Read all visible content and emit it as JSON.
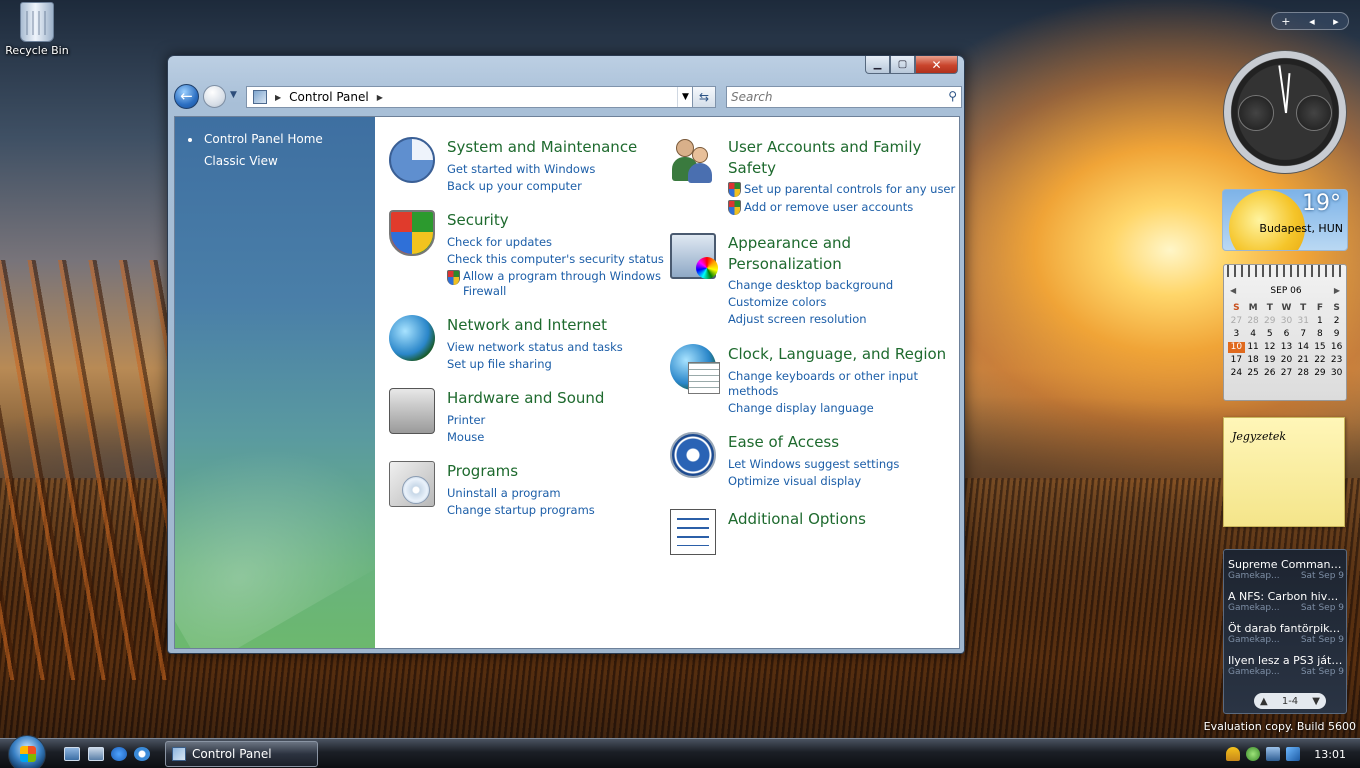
{
  "desktop": {
    "recycle_bin_label": "Recycle Bin",
    "evaluation_text": "Evaluation copy. Build 5600"
  },
  "window": {
    "address": {
      "segment": "Control Panel"
    },
    "search": {
      "placeholder": "Search"
    },
    "sidebar": {
      "home_label": "Control Panel Home",
      "classic_label": "Classic View"
    },
    "categories": {
      "system": {
        "title": "System and Maintenance",
        "links": [
          "Get started with Windows",
          "Back up your computer"
        ]
      },
      "security": {
        "title": "Security",
        "links": [
          "Check for updates",
          "Check this computer's security status",
          "Allow a program through Windows Firewall"
        ]
      },
      "network": {
        "title": "Network and Internet",
        "links": [
          "View network status and tasks",
          "Set up file sharing"
        ]
      },
      "hardware": {
        "title": "Hardware and Sound",
        "links": [
          "Printer",
          "Mouse"
        ]
      },
      "programs": {
        "title": "Programs",
        "links": [
          "Uninstall a program",
          "Change startup programs"
        ]
      },
      "users": {
        "title": "User Accounts and Family Safety",
        "links": [
          "Set up parental controls for any user",
          "Add or remove user accounts"
        ]
      },
      "appearance": {
        "title": "Appearance and Personalization",
        "links": [
          "Change desktop background",
          "Customize colors",
          "Adjust screen resolution"
        ]
      },
      "clock": {
        "title": "Clock, Language, and Region",
        "links": [
          "Change keyboards or other input methods",
          "Change display language"
        ]
      },
      "ease": {
        "title": "Ease of Access",
        "links": [
          "Let Windows suggest settings",
          "Optimize visual display"
        ]
      },
      "additional": {
        "title": "Additional Options"
      }
    }
  },
  "gadgets": {
    "weather": {
      "temp": "19°",
      "city": "Budapest, HUN"
    },
    "calendar": {
      "month": "SEP 06",
      "dow": [
        "S",
        "M",
        "T",
        "W",
        "T",
        "F",
        "S"
      ],
      "weeks": [
        [
          "27",
          "28",
          "29",
          "30",
          "31",
          "1",
          "2"
        ],
        [
          "3",
          "4",
          "5",
          "6",
          "7",
          "8",
          "9"
        ],
        [
          "10",
          "11",
          "12",
          "13",
          "14",
          "15",
          "16"
        ],
        [
          "17",
          "18",
          "19",
          "20",
          "21",
          "22",
          "23"
        ],
        [
          "24",
          "25",
          "26",
          "27",
          "28",
          "29",
          "30"
        ]
      ],
      "today": "10"
    },
    "notes": {
      "text": "Jegyzetek"
    },
    "feeds": {
      "items": [
        {
          "title": "Supreme Command...",
          "source": "Gamekap...",
          "date": "Sat Sep 9"
        },
        {
          "title": "A NFS: Carbon hivat...",
          "source": "Gamekap...",
          "date": "Sat Sep 9"
        },
        {
          "title": "Öt darab fantörpiku...",
          "source": "Gamekap...",
          "date": "Sat Sep 9"
        },
        {
          "title": "Ilyen lesz a PS3 játé...",
          "source": "Gamekap...",
          "date": "Sat Sep 9"
        }
      ],
      "page": "1-4"
    }
  },
  "taskbar": {
    "task_label": "Control Panel",
    "time": "13:01"
  }
}
